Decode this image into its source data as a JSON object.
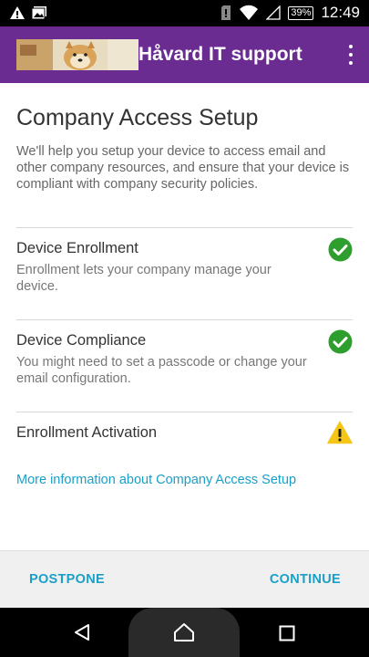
{
  "status_bar": {
    "battery": "39%",
    "time": "12:49"
  },
  "app_bar": {
    "title": "Håvard IT support"
  },
  "page": {
    "title": "Company Access Setup",
    "intro": "We'll help you setup your device to access email and other company resources, and ensure that your device is compliant with company security policies."
  },
  "steps": [
    {
      "title": "Device Enrollment",
      "description": "Enrollment lets your company manage your device.",
      "status": "complete",
      "status_color": "#2e9e2e"
    },
    {
      "title": "Device Compliance",
      "description": "You might need to set a passcode or change your email configuration.",
      "status": "complete",
      "status_color": "#2e9e2e"
    },
    {
      "title": "Enrollment Activation",
      "description": "",
      "status": "warning",
      "status_color": "#f5c518"
    }
  ],
  "more_info_link": "More information about Company Access Setup",
  "actions": {
    "postpone": "POSTPONE",
    "continue": "CONTINUE"
  },
  "colors": {
    "app_bar": "#6a2c91",
    "accent": "#1a9fc8"
  }
}
